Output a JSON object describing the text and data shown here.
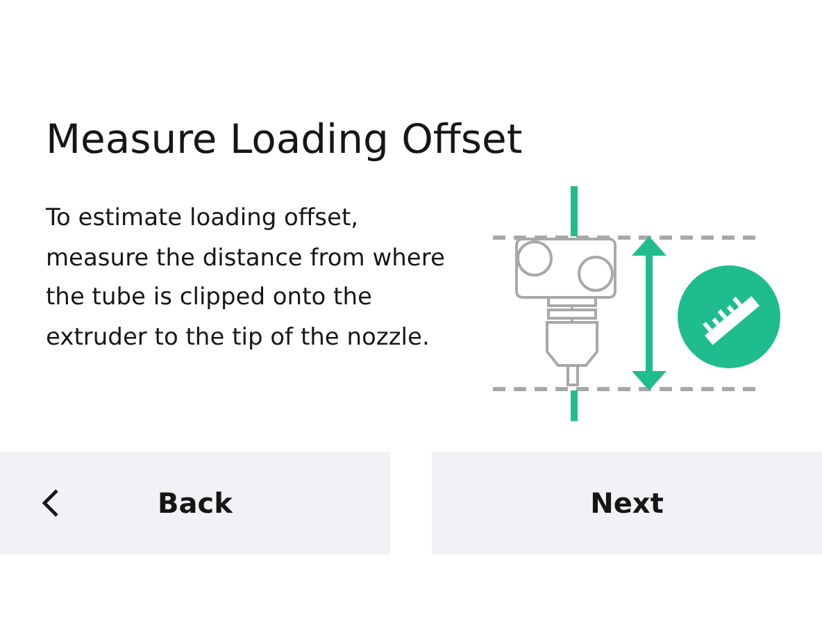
{
  "title": "Measure Loading Offset",
  "description": "To estimate loading offset, measure the distance from where the tube is clipped onto the extruder to the tip of the nozzle.",
  "buttons": [
    {
      "kind": "back",
      "label": "Back"
    },
    {
      "kind": "next",
      "label": "Next"
    }
  ]
}
